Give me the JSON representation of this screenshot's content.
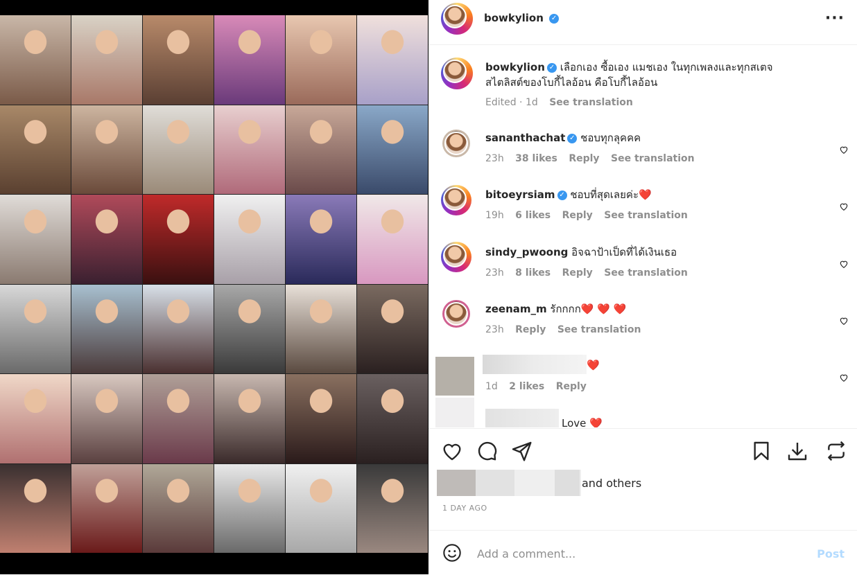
{
  "post": {
    "username": "bowkylion",
    "caption_user": "bowkylion",
    "caption_line1": "เลือกเอง ซื้อเอง แมชเอง ในทุกเพลงและทุกสเตจ",
    "caption_line2": "สไตลิสต์ของโบกี้ไลอ้อน คือโบกี้ไลอ้อน ",
    "caption_edited": "Edited · 1d",
    "see_translation": "See translation"
  },
  "comments": [
    {
      "user": "sananthachat",
      "verified": true,
      "text": "ชอบทุกลุคคค",
      "time": "23h",
      "likes": "38 likes",
      "reply": "Reply",
      "translate": "See translation"
    },
    {
      "user": "bitoeyrsiam",
      "verified": true,
      "text": "ชอบที่สุดเลยค่ะ❤️",
      "time": "19h",
      "likes": "6 likes",
      "reply": "Reply",
      "translate": "See translation"
    },
    {
      "user": "sindy_pwoong",
      "verified": false,
      "text": "อิจฉาป้าเป็ดที่ได้เงินเธอ",
      "time": "23h",
      "likes": "8 likes",
      "reply": "Reply",
      "translate": "See translation"
    },
    {
      "user": "zeenam_m",
      "verified": false,
      "text": "รักกกก❤️ ❤️ ❤️",
      "time": "23h",
      "likes": "",
      "reply": "Reply",
      "translate": "See translation"
    },
    {
      "user": "",
      "verified": false,
      "text": "❤️",
      "time": "1d",
      "likes": "2 likes",
      "reply": "Reply",
      "translate": ""
    },
    {
      "user": "",
      "verified": false,
      "text": "Love ❤️",
      "time": "",
      "likes": "",
      "reply": "",
      "translate": ""
    }
  ],
  "likes_text": "and others",
  "date_text": "1 DAY AGO",
  "comment_input": {
    "placeholder": "Add a comment..."
  },
  "post_button": "Post",
  "icons": [
    "more-icon",
    "heart-icon",
    "comment-icon",
    "share-icon",
    "bookmark-icon",
    "download-icon",
    "repost-icon",
    "emoji-icon"
  ],
  "colors": {
    "verified": "#3897f0",
    "post_disabled": "#b3dbff",
    "muted": "#8e8e8e",
    "like_heart": "#ed4956"
  }
}
